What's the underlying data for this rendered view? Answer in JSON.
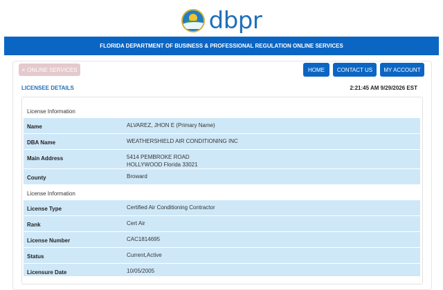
{
  "brand": {
    "name": "dbpr"
  },
  "banner": {
    "title": "FLORIDA DEPARTMENT OF BUSINESS & PROFESSIONAL REGULATION ONLINE SERVICES"
  },
  "toolbar": {
    "online_services": "ONLINE SERVICES",
    "home": "HOME",
    "contact_us": "CONTACT US",
    "my_account": "MY ACCOUNT"
  },
  "page": {
    "section_title": "LICENSEE DETAILS",
    "timestamp": "2:21:45 AM 9/29/2026 EST"
  },
  "licensee": {
    "group_label": "License Information",
    "name_label": "Name",
    "name_value": "ALVAREZ, JHON E (Primary Name)",
    "dba_label": "DBA Name",
    "dba_value": "WEATHERSHIELD AIR CONDITIONING INC",
    "address_label": "Main Address",
    "address_line1": "5414 PEMBROKE ROAD",
    "address_line2": "HOLLYWOOD Florida 33021",
    "county_label": "County",
    "county_value": "Broward"
  },
  "license": {
    "group_label": "License Information",
    "type_label": "License Type",
    "type_value": "Certified Air Conditioning Contractor",
    "rank_label": "Rank",
    "rank_value": "Cert Air",
    "number_label": "License Number",
    "number_value": "CAC1814695",
    "status_label": "Status",
    "status_value": "Current,Active",
    "date_label": "Licensure Date",
    "date_value": "10/05/2005"
  },
  "colors": {
    "primary_blue": "#0b66c3",
    "row_blue": "#cfe8f8",
    "disabled_pink": "#e4c9cd"
  }
}
